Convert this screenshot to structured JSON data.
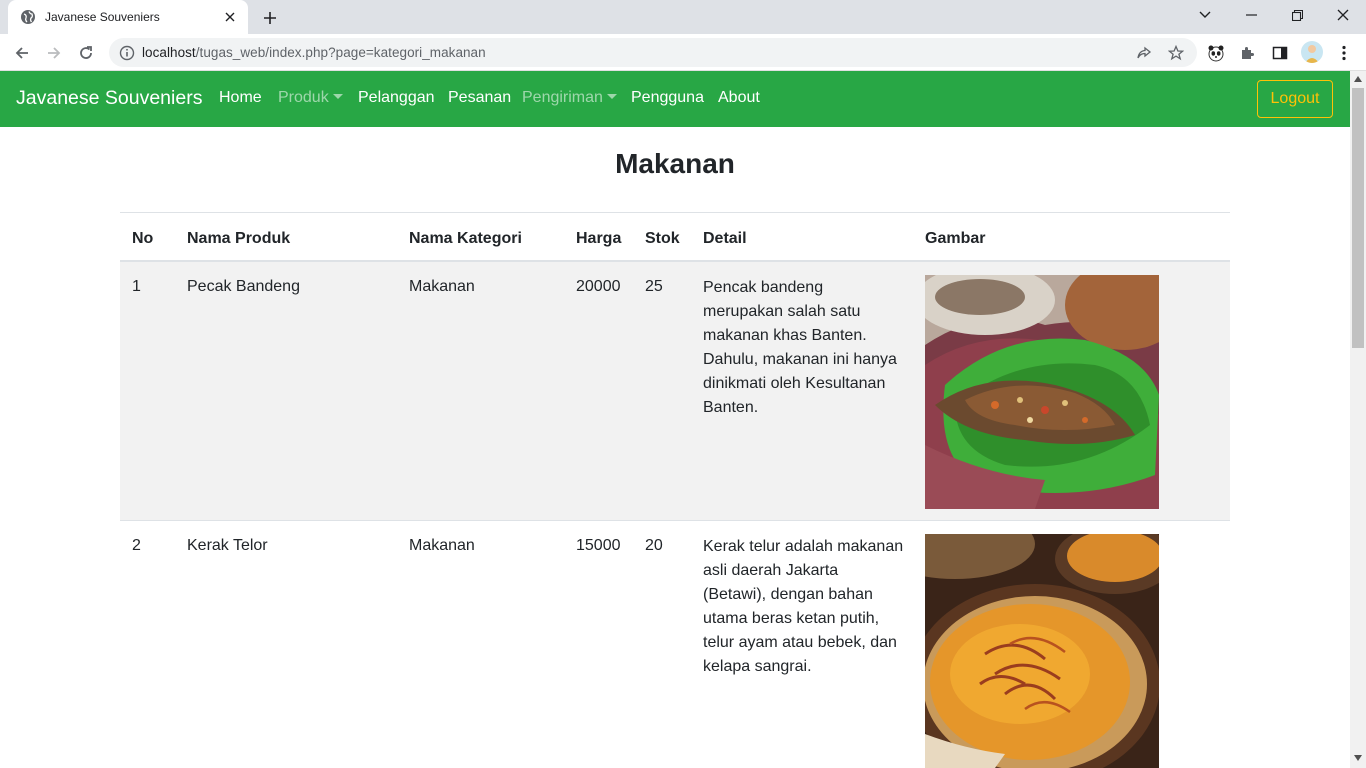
{
  "browser": {
    "tab_title": "Javanese Souveniers",
    "url_host": "localhost",
    "url_path": "/tugas_web/index.php?page=kategori_makanan"
  },
  "navbar": {
    "brand": "Javanese Souveniers",
    "items": [
      {
        "label": "Home"
      },
      {
        "label": "Produk"
      },
      {
        "label": "Pelanggan"
      },
      {
        "label": "Pesanan"
      },
      {
        "label": "Pengiriman"
      },
      {
        "label": "Pengguna"
      },
      {
        "label": "About"
      }
    ],
    "logout": "Logout",
    "colors": {
      "bg": "#28a745",
      "logout": "#ffc107"
    }
  },
  "page": {
    "title": "Makanan"
  },
  "table": {
    "headers": [
      "No",
      "Nama Produk",
      "Nama Kategori",
      "Harga",
      "Stok",
      "Detail",
      "Gambar"
    ],
    "rows": [
      {
        "no": "1",
        "nama_produk": "Pecak Bandeng",
        "kategori": "Makanan",
        "harga": "20000",
        "stok": "25",
        "detail": "Pencak bandeng merupakan salah satu makanan khas Banten. Dahulu, makanan ini hanya dinikmati oleh Kesultanan Banten."
      },
      {
        "no": "2",
        "nama_produk": "Kerak Telor",
        "kategori": "Makanan",
        "harga": "15000",
        "stok": "20",
        "detail": "Kerak telur adalah makanan asli daerah Jakarta (Betawi), dengan bahan utama beras ketan putih, telur ayam atau bebek, dan kelapa sangrai."
      }
    ]
  }
}
